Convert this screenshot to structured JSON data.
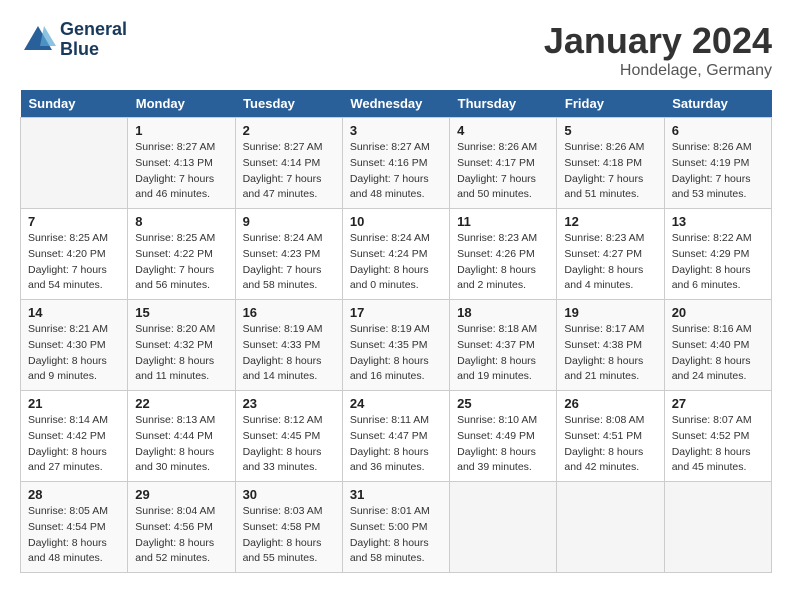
{
  "header": {
    "logo_line1": "General",
    "logo_line2": "Blue",
    "month": "January 2024",
    "location": "Hondelage, Germany"
  },
  "days_of_week": [
    "Sunday",
    "Monday",
    "Tuesday",
    "Wednesday",
    "Thursday",
    "Friday",
    "Saturday"
  ],
  "weeks": [
    [
      {
        "day": "",
        "info": ""
      },
      {
        "day": "1",
        "info": "Sunrise: 8:27 AM\nSunset: 4:13 PM\nDaylight: 7 hours\nand 46 minutes."
      },
      {
        "day": "2",
        "info": "Sunrise: 8:27 AM\nSunset: 4:14 PM\nDaylight: 7 hours\nand 47 minutes."
      },
      {
        "day": "3",
        "info": "Sunrise: 8:27 AM\nSunset: 4:16 PM\nDaylight: 7 hours\nand 48 minutes."
      },
      {
        "day": "4",
        "info": "Sunrise: 8:26 AM\nSunset: 4:17 PM\nDaylight: 7 hours\nand 50 minutes."
      },
      {
        "day": "5",
        "info": "Sunrise: 8:26 AM\nSunset: 4:18 PM\nDaylight: 7 hours\nand 51 minutes."
      },
      {
        "day": "6",
        "info": "Sunrise: 8:26 AM\nSunset: 4:19 PM\nDaylight: 7 hours\nand 53 minutes."
      }
    ],
    [
      {
        "day": "7",
        "info": "Sunrise: 8:25 AM\nSunset: 4:20 PM\nDaylight: 7 hours\nand 54 minutes."
      },
      {
        "day": "8",
        "info": "Sunrise: 8:25 AM\nSunset: 4:22 PM\nDaylight: 7 hours\nand 56 minutes."
      },
      {
        "day": "9",
        "info": "Sunrise: 8:24 AM\nSunset: 4:23 PM\nDaylight: 7 hours\nand 58 minutes."
      },
      {
        "day": "10",
        "info": "Sunrise: 8:24 AM\nSunset: 4:24 PM\nDaylight: 8 hours\nand 0 minutes."
      },
      {
        "day": "11",
        "info": "Sunrise: 8:23 AM\nSunset: 4:26 PM\nDaylight: 8 hours\nand 2 minutes."
      },
      {
        "day": "12",
        "info": "Sunrise: 8:23 AM\nSunset: 4:27 PM\nDaylight: 8 hours\nand 4 minutes."
      },
      {
        "day": "13",
        "info": "Sunrise: 8:22 AM\nSunset: 4:29 PM\nDaylight: 8 hours\nand 6 minutes."
      }
    ],
    [
      {
        "day": "14",
        "info": "Sunrise: 8:21 AM\nSunset: 4:30 PM\nDaylight: 8 hours\nand 9 minutes."
      },
      {
        "day": "15",
        "info": "Sunrise: 8:20 AM\nSunset: 4:32 PM\nDaylight: 8 hours\nand 11 minutes."
      },
      {
        "day": "16",
        "info": "Sunrise: 8:19 AM\nSunset: 4:33 PM\nDaylight: 8 hours\nand 14 minutes."
      },
      {
        "day": "17",
        "info": "Sunrise: 8:19 AM\nSunset: 4:35 PM\nDaylight: 8 hours\nand 16 minutes."
      },
      {
        "day": "18",
        "info": "Sunrise: 8:18 AM\nSunset: 4:37 PM\nDaylight: 8 hours\nand 19 minutes."
      },
      {
        "day": "19",
        "info": "Sunrise: 8:17 AM\nSunset: 4:38 PM\nDaylight: 8 hours\nand 21 minutes."
      },
      {
        "day": "20",
        "info": "Sunrise: 8:16 AM\nSunset: 4:40 PM\nDaylight: 8 hours\nand 24 minutes."
      }
    ],
    [
      {
        "day": "21",
        "info": "Sunrise: 8:14 AM\nSunset: 4:42 PM\nDaylight: 8 hours\nand 27 minutes."
      },
      {
        "day": "22",
        "info": "Sunrise: 8:13 AM\nSunset: 4:44 PM\nDaylight: 8 hours\nand 30 minutes."
      },
      {
        "day": "23",
        "info": "Sunrise: 8:12 AM\nSunset: 4:45 PM\nDaylight: 8 hours\nand 33 minutes."
      },
      {
        "day": "24",
        "info": "Sunrise: 8:11 AM\nSunset: 4:47 PM\nDaylight: 8 hours\nand 36 minutes."
      },
      {
        "day": "25",
        "info": "Sunrise: 8:10 AM\nSunset: 4:49 PM\nDaylight: 8 hours\nand 39 minutes."
      },
      {
        "day": "26",
        "info": "Sunrise: 8:08 AM\nSunset: 4:51 PM\nDaylight: 8 hours\nand 42 minutes."
      },
      {
        "day": "27",
        "info": "Sunrise: 8:07 AM\nSunset: 4:52 PM\nDaylight: 8 hours\nand 45 minutes."
      }
    ],
    [
      {
        "day": "28",
        "info": "Sunrise: 8:05 AM\nSunset: 4:54 PM\nDaylight: 8 hours\nand 48 minutes."
      },
      {
        "day": "29",
        "info": "Sunrise: 8:04 AM\nSunset: 4:56 PM\nDaylight: 8 hours\nand 52 minutes."
      },
      {
        "day": "30",
        "info": "Sunrise: 8:03 AM\nSunset: 4:58 PM\nDaylight: 8 hours\nand 55 minutes."
      },
      {
        "day": "31",
        "info": "Sunrise: 8:01 AM\nSunset: 5:00 PM\nDaylight: 8 hours\nand 58 minutes."
      },
      {
        "day": "",
        "info": ""
      },
      {
        "day": "",
        "info": ""
      },
      {
        "day": "",
        "info": ""
      }
    ]
  ]
}
